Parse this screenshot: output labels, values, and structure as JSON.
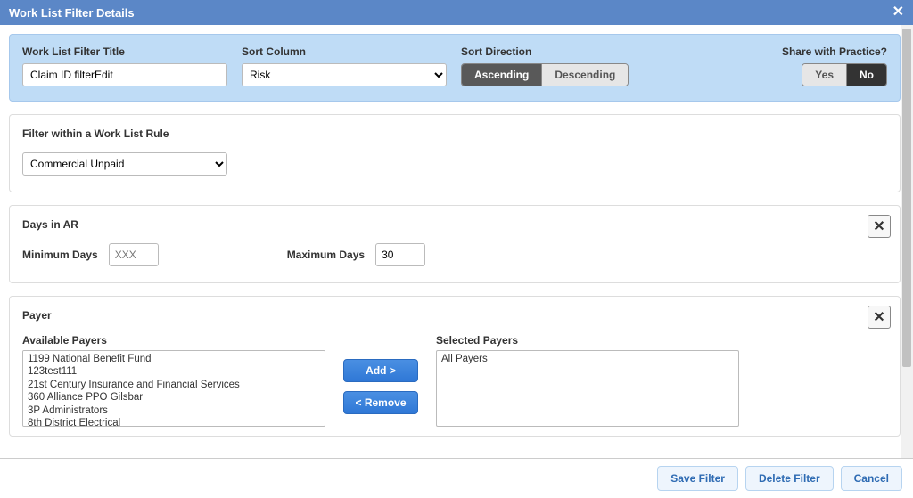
{
  "dialog": {
    "title": "Work List Filter Details"
  },
  "top": {
    "title_label": "Work List Filter Title",
    "title_value": "Claim ID filterEdit",
    "sort_col_label": "Sort Column",
    "sort_col_value": "Risk",
    "sort_dir_label": "Sort Direction",
    "sort_dir_asc": "Ascending",
    "sort_dir_desc": "Descending",
    "share_label": "Share with Practice?",
    "share_yes": "Yes",
    "share_no": "No"
  },
  "rule": {
    "heading": "Filter within a Work List Rule",
    "value": "Commercial Unpaid"
  },
  "ar": {
    "heading": "Days in AR",
    "min_label": "Minimum Days",
    "min_placeholder": "XXX",
    "max_label": "Maximum Days",
    "max_value": "30"
  },
  "payer": {
    "heading": "Payer",
    "available_label": "Available Payers",
    "selected_label": "Selected Payers",
    "add_btn": "Add >",
    "remove_btn": "< Remove",
    "available": [
      "1199 National Benefit Fund",
      "123test111",
      "21st Century Insurance and Financial Services",
      "360 Alliance PPO Gilsbar",
      "3P Administrators",
      "8th District Electrical"
    ],
    "selected": [
      "All Payers"
    ]
  },
  "footer": {
    "save": "Save Filter",
    "del": "Delete Filter",
    "cancel": "Cancel"
  }
}
